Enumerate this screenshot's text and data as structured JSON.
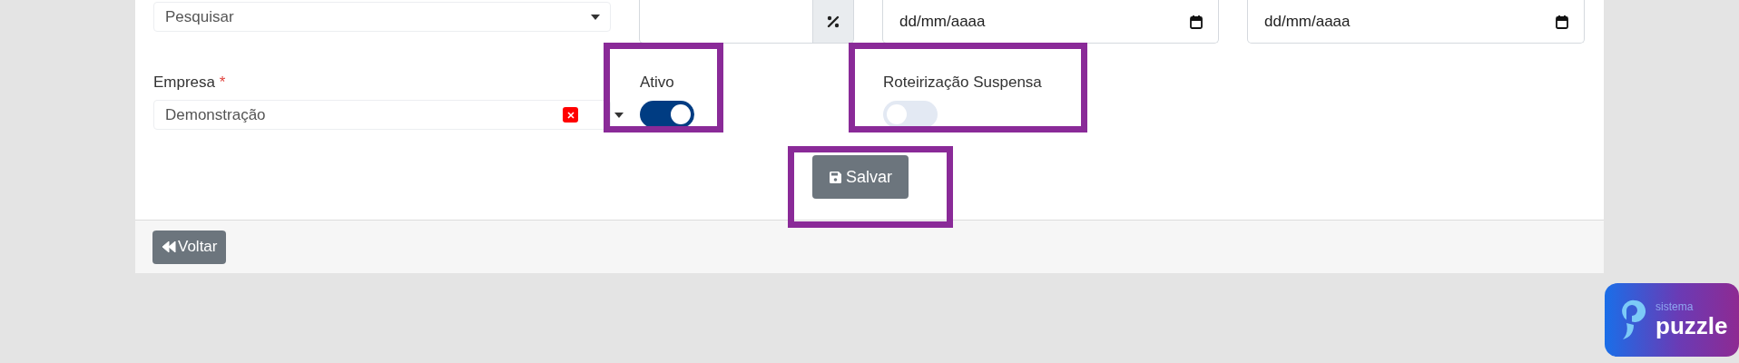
{
  "filters": {
    "search_select": {
      "placeholder": "Pesquisar"
    },
    "date_from": {
      "placeholder": "dd/mm/aaaa"
    },
    "date_to": {
      "placeholder": "dd/mm/aaaa"
    }
  },
  "company": {
    "label": "Empresa",
    "required_mark": "*",
    "value": "Demonstração",
    "clearable": true
  },
  "toggles": [
    {
      "label": "Ativo",
      "on": true,
      "highlighted": true
    },
    {
      "label": "Roteirização Suspensa",
      "on": false,
      "highlighted": true
    }
  ],
  "save_button": {
    "label": "Salvar",
    "highlighted": true
  },
  "back_button": {
    "label": "Voltar"
  },
  "badge": {
    "small": "sistema",
    "large": "puzzle"
  }
}
